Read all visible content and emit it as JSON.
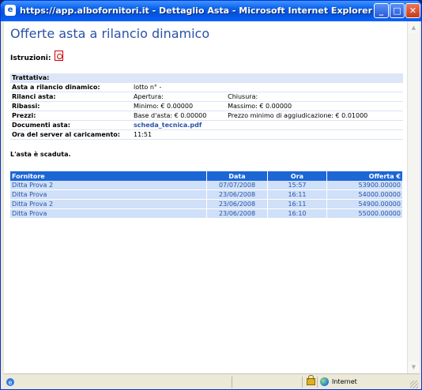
{
  "window": {
    "title": "https://app.albofornitori.it - Dettaglio Asta - Microsoft Internet Explorer",
    "buttons": {
      "minimize": "_",
      "maximize": "□",
      "close": "✕"
    }
  },
  "page": {
    "heading": "Offerte asta a rilancio dinamico",
    "instructions_label": "Istruzioni:",
    "expired_message": "L'asta è scaduta."
  },
  "info": {
    "trattativa_label": "Trattativa:",
    "trattativa_value": "",
    "asta_label": "Asta a rilancio dinamico:",
    "asta_value": "lotto n° -",
    "rilanci_label": "Rilanci asta:",
    "apertura": "Apertura:",
    "chiusura": "Chiusura:",
    "ribassi_label": "Ribassi:",
    "minimo": "Minimo: € 0.00000",
    "massimo": "Massimo: € 0.00000",
    "prezzi_label": "Prezzi:",
    "base_asta": "Base d'asta: € 0.00000",
    "prezzo_minimo": "Prezzo minimo di aggiudicazione: € 0.01000",
    "documenti_label": "Documenti asta:",
    "documento_link": "scheda_tecnica.pdf",
    "ora_label": "Ora del server al caricamento:",
    "ora_value": "11:51"
  },
  "offers": {
    "headers": [
      "Fornitore",
      "Data",
      "Ora",
      "Offerta €"
    ],
    "rows": [
      [
        "Ditta Prova 2",
        "07/07/2008",
        "15:57",
        "53900.00000"
      ],
      [
        "Ditta Prova",
        "23/06/2008",
        "16:11",
        "54000.00000"
      ],
      [
        "Ditta Prova 2",
        "23/06/2008",
        "16:11",
        "54900.00000"
      ],
      [
        "Ditta Prova",
        "23/06/2008",
        "16:10",
        "55000.00000"
      ]
    ]
  },
  "statusbar": {
    "zone": "Internet"
  },
  "icons": [
    "ie-icon",
    "pdf-icon",
    "lock-icon",
    "globe-icon"
  ],
  "colors": {
    "accent": "#1c66d6",
    "link": "#2a52a8",
    "row_bg": "#cfe0f8"
  }
}
